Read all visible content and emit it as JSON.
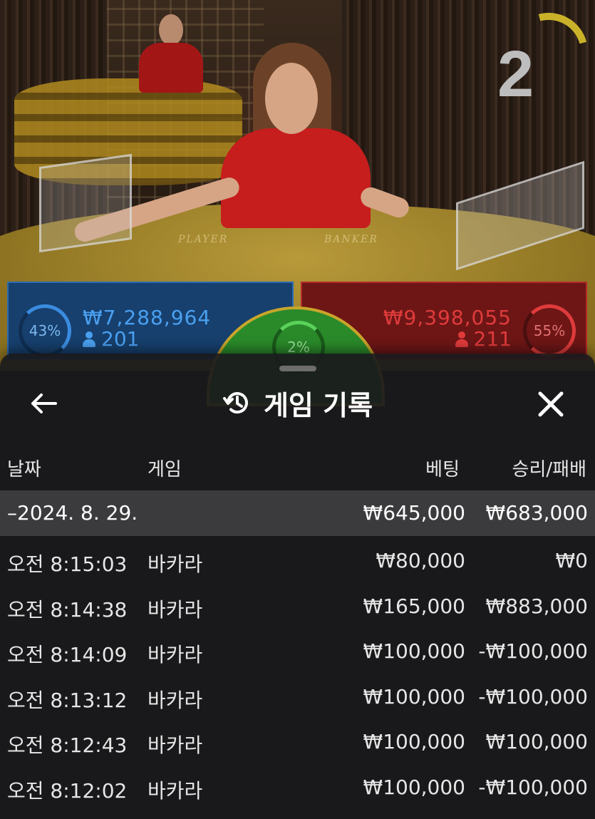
{
  "stream": {
    "timer": "2",
    "table_labels": {
      "player": "PLAYER",
      "banker": "BANKER"
    }
  },
  "bets": {
    "player": {
      "percent": "43%",
      "amount": "₩7,288,964",
      "players": "201",
      "color": "#2a6bb5"
    },
    "tie": {
      "percent": "2%",
      "color": "#2a8a2a"
    },
    "banker": {
      "percent": "55%",
      "amount": "₩9,398,055",
      "players": "211",
      "color": "#b52a2a"
    }
  },
  "sheet": {
    "title": "게임 기록",
    "icons": {
      "back": "arrow-left-icon",
      "history": "history-icon",
      "close": "close-icon"
    },
    "columns": {
      "date": "날짜",
      "game": "게임",
      "bet": "베팅",
      "result": "승리/패배"
    },
    "date_group": {
      "date": "–2024. 8. 29.",
      "bet_total": "₩645,000",
      "result_total": "₩683,000"
    },
    "rows": [
      {
        "time": "오전 8:15:03",
        "game": "바카라",
        "bet": "₩80,000",
        "result": "₩0"
      },
      {
        "time": "오전 8:14:38",
        "game": "바카라",
        "bet": "₩165,000",
        "result": "₩883,000"
      },
      {
        "time": "오전 8:14:09",
        "game": "바카라",
        "bet": "₩100,000",
        "result": "-₩100,000"
      },
      {
        "time": "오전 8:13:12",
        "game": "바카라",
        "bet": "₩100,000",
        "result": "-₩100,000"
      },
      {
        "time": "오전 8:12:43",
        "game": "바카라",
        "bet": "₩100,000",
        "result": "₩100,000"
      },
      {
        "time": "오전 8:12:02",
        "game": "바카라",
        "bet": "₩100,000",
        "result": "-₩100,000"
      }
    ]
  }
}
